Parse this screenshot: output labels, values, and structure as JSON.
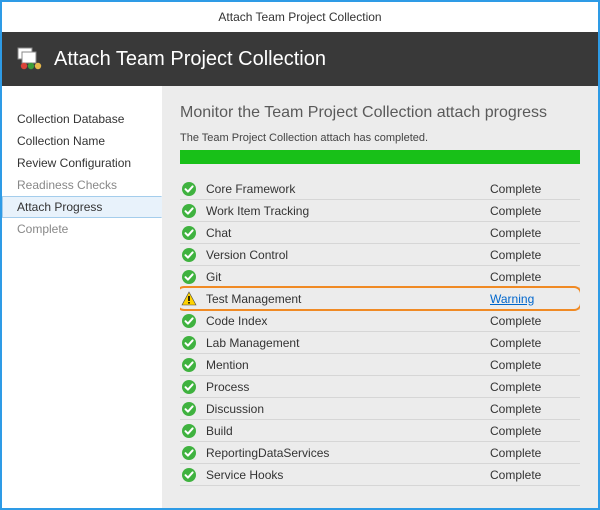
{
  "window": {
    "title": "Attach Team Project Collection"
  },
  "banner": {
    "title": "Attach Team Project Collection"
  },
  "sidebar": {
    "items": [
      {
        "label": "Collection Database",
        "state": "normal"
      },
      {
        "label": "Collection Name",
        "state": "normal"
      },
      {
        "label": "Review Configuration",
        "state": "normal"
      },
      {
        "label": "Readiness Checks",
        "state": "disabled"
      },
      {
        "label": "Attach Progress",
        "state": "selected"
      },
      {
        "label": "Complete",
        "state": "disabled"
      }
    ]
  },
  "main": {
    "heading": "Monitor the Team Project Collection attach progress",
    "subtext": "The Team Project Collection attach has completed.",
    "items": [
      {
        "label": "Core Framework",
        "status": "Complete",
        "icon": "success"
      },
      {
        "label": "Work Item Tracking",
        "status": "Complete",
        "icon": "success"
      },
      {
        "label": "Chat",
        "status": "Complete",
        "icon": "success"
      },
      {
        "label": "Version Control",
        "status": "Complete",
        "icon": "success"
      },
      {
        "label": "Git",
        "status": "Complete",
        "icon": "success"
      },
      {
        "label": "Test Management",
        "status": "Warning",
        "icon": "warning",
        "link": true,
        "highlight": true
      },
      {
        "label": "Code Index",
        "status": "Complete",
        "icon": "success"
      },
      {
        "label": "Lab Management",
        "status": "Complete",
        "icon": "success"
      },
      {
        "label": "Mention",
        "status": "Complete",
        "icon": "success"
      },
      {
        "label": "Process",
        "status": "Complete",
        "icon": "success"
      },
      {
        "label": "Discussion",
        "status": "Complete",
        "icon": "success"
      },
      {
        "label": "Build",
        "status": "Complete",
        "icon": "success"
      },
      {
        "label": "ReportingDataServices",
        "status": "Complete",
        "icon": "success"
      },
      {
        "label": "Service Hooks",
        "status": "Complete",
        "icon": "success"
      }
    ]
  }
}
